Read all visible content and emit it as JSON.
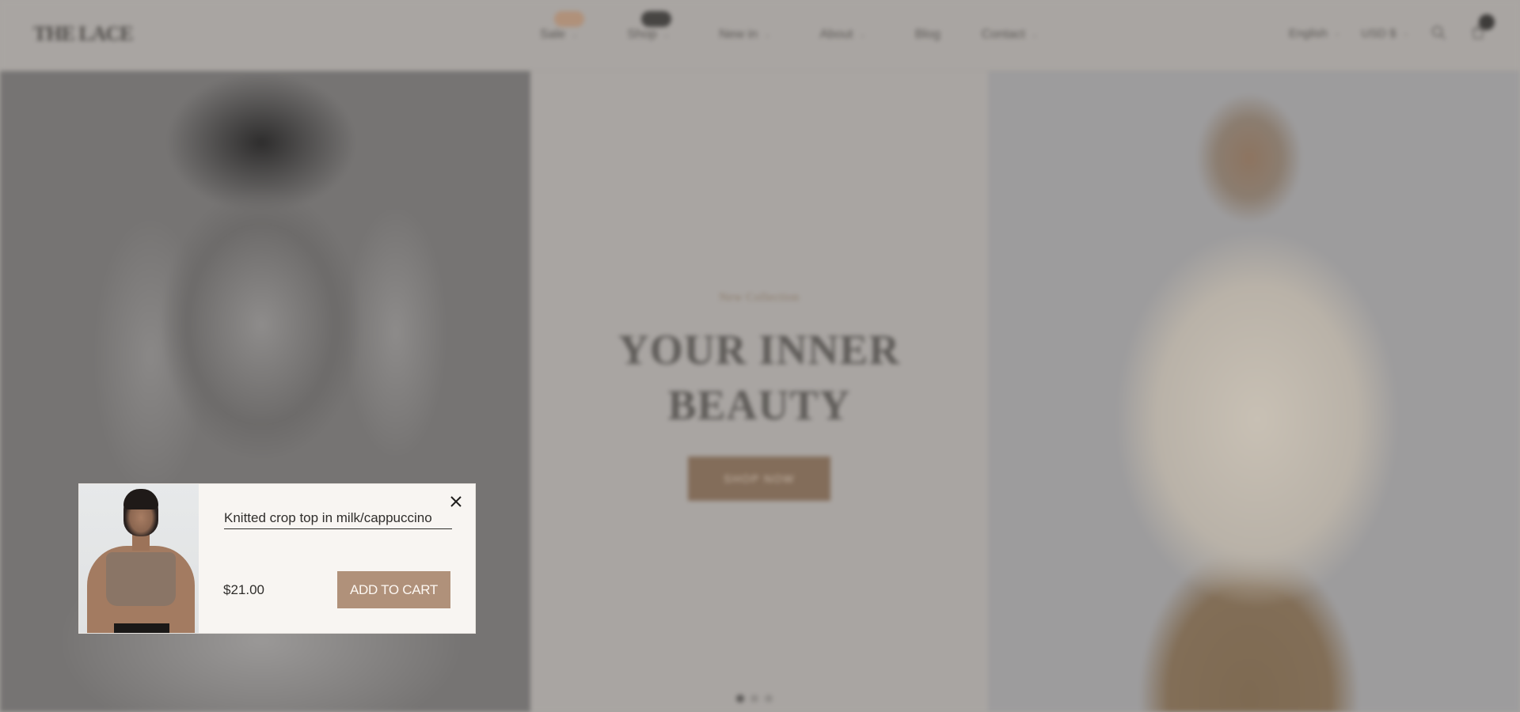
{
  "header": {
    "logo": "THE LACE",
    "nav": [
      {
        "label": "Sale",
        "has_dropdown": true,
        "badge": "",
        "badge_color": "#b0917a"
      },
      {
        "label": "Shop",
        "has_dropdown": true,
        "badge": "",
        "badge_color": "#474543"
      },
      {
        "label": "New in",
        "has_dropdown": true
      },
      {
        "label": "About",
        "has_dropdown": true
      },
      {
        "label": "Blog",
        "has_dropdown": false
      },
      {
        "label": "Contact",
        "has_dropdown": true
      }
    ],
    "language": "English",
    "currency": "USD $",
    "search_icon": "search-icon",
    "cart_icon": "cart-icon",
    "cart_count": ""
  },
  "hero": {
    "subtitle": "New Collection",
    "title_line1": "YOUR INNER",
    "title_line2": "BEAUTY",
    "cta": "SHOP NOW",
    "slides": 3,
    "active_slide": 1
  },
  "popup": {
    "product_title": "Knitted crop top in milk/cappuccino",
    "price": "$21.00",
    "add_to_cart": "ADD TO CART",
    "close_icon": "close-icon"
  },
  "colors": {
    "accent": "#b0917a",
    "popup_bg": "#f8f5f2",
    "text_dark": "#2f2d2b",
    "overlay": "#a9a5a2"
  }
}
